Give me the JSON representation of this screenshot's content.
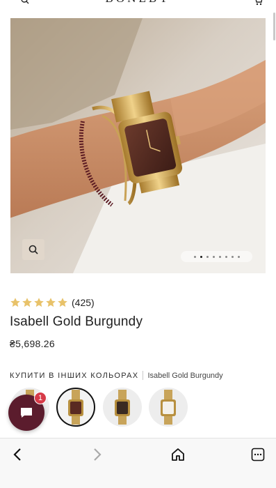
{
  "header": {
    "brand": "BONEBY"
  },
  "product": {
    "rating_count": "(425)",
    "stars": 5,
    "name": "Isabell Gold Burgundy",
    "price": "₴5,698.26"
  },
  "gallery": {
    "total_images": 8,
    "active_image": 2
  },
  "colors": {
    "heading": "КУПИТИ В ІНШИХ КОЛЬОРАХ",
    "current": "Isabell Gold Burgundy"
  },
  "chat": {
    "badge": "1"
  },
  "theme": {
    "star_color": "#e8c26a",
    "chat_color": "#5b1c2d",
    "badge_color": "#d63a48"
  }
}
